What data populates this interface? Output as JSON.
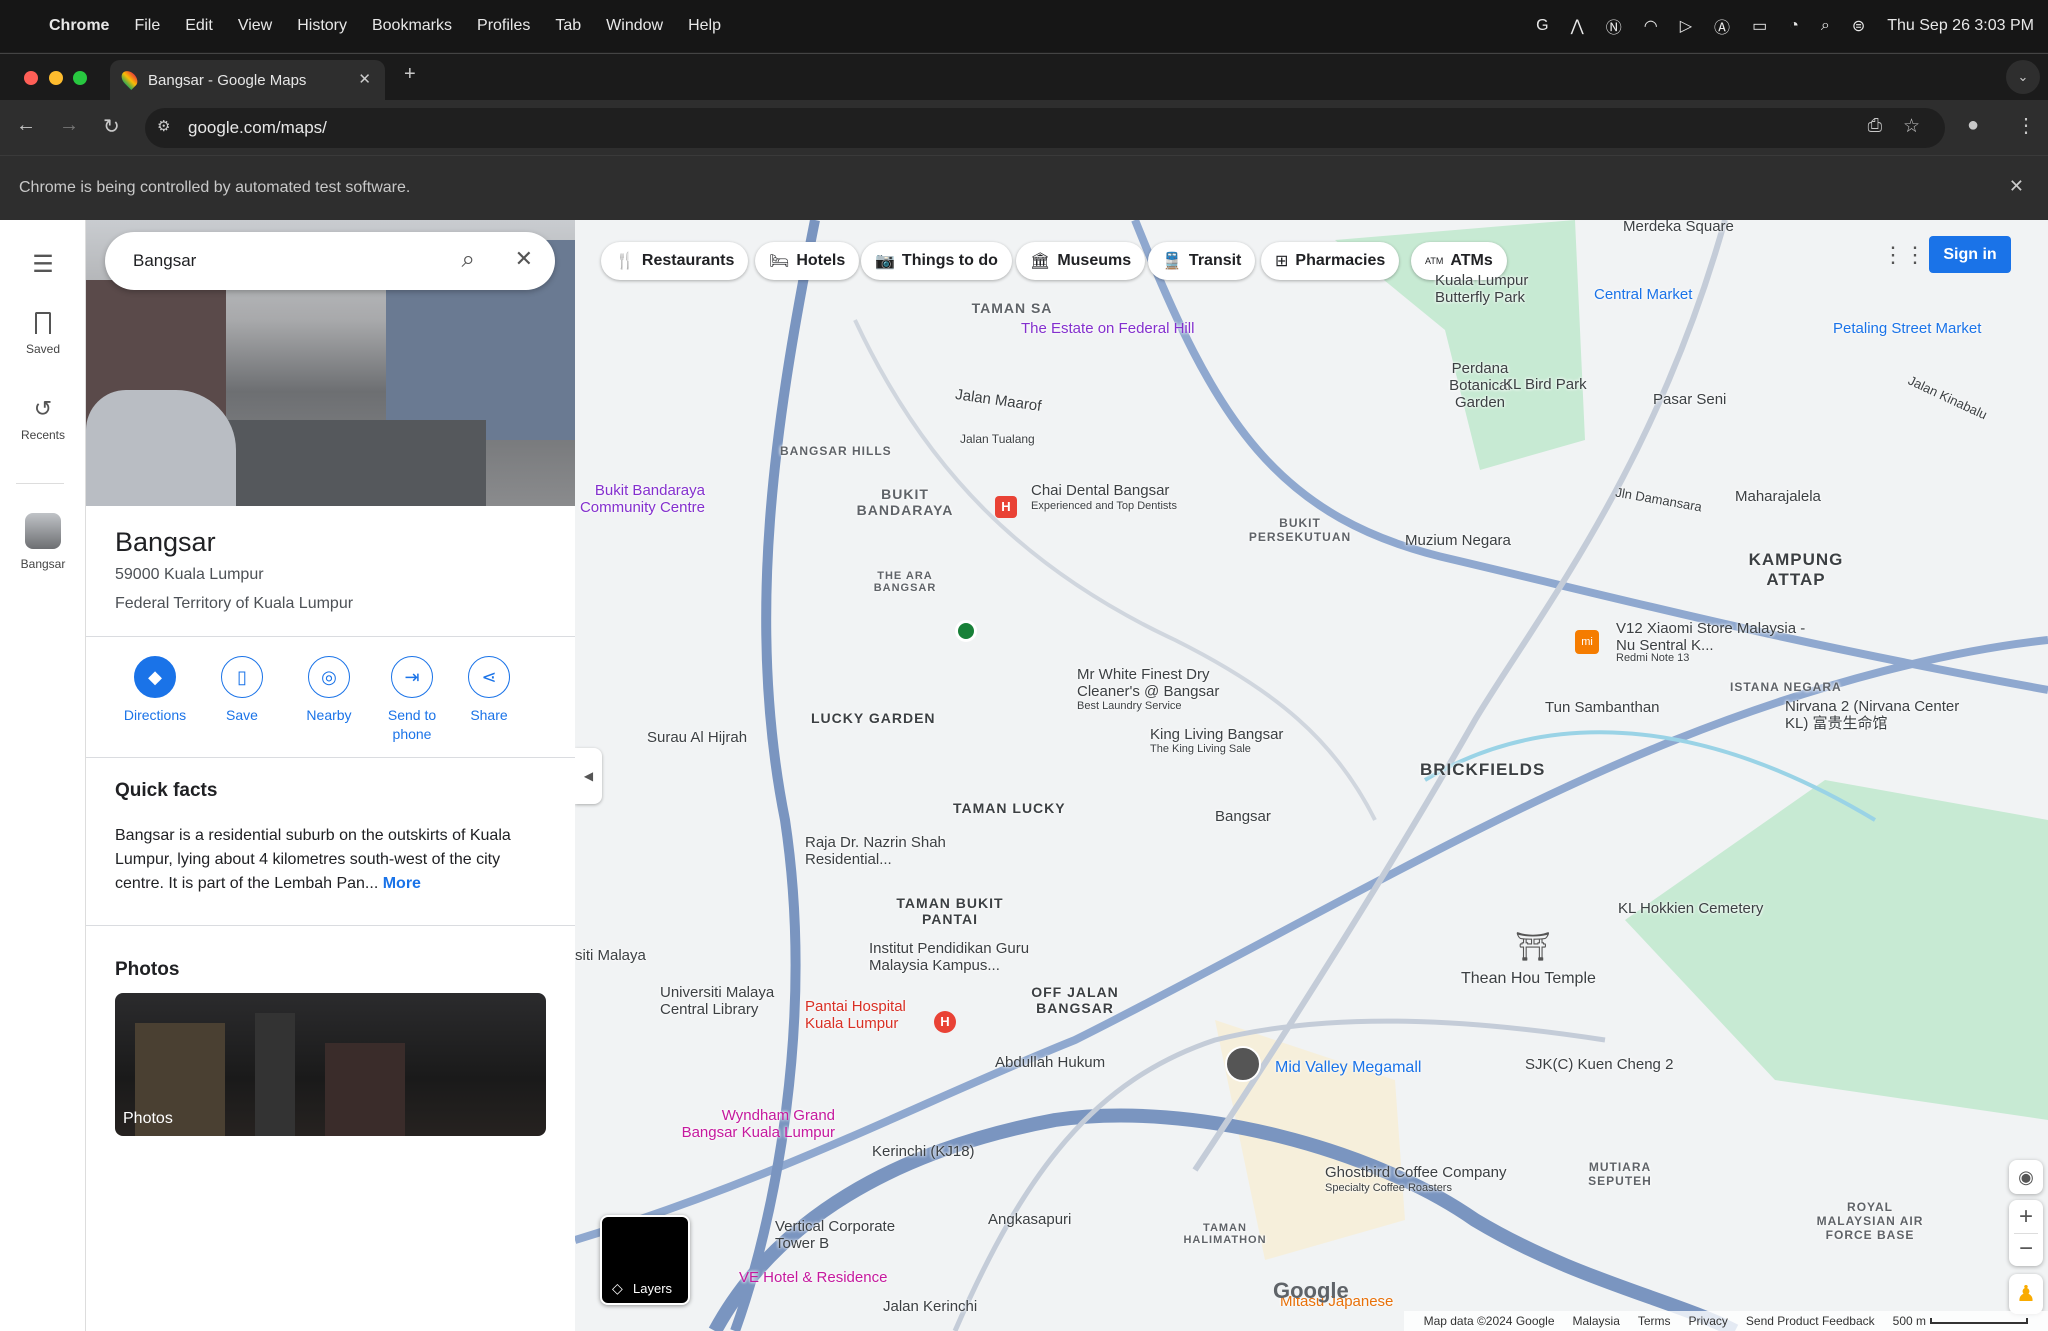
{
  "menubar": {
    "app": "Chrome",
    "items": [
      "File",
      "Edit",
      "View",
      "History",
      "Bookmarks",
      "Profiles",
      "Tab",
      "Window",
      "Help"
    ],
    "clock": "Thu Sep 26  3:03 PM"
  },
  "browser": {
    "tab_title": "Bangsar - Google Maps",
    "url": "google.com/maps/",
    "infobar": "Chrome is being controlled by automated test software."
  },
  "rail": {
    "saved": "Saved",
    "recents": "Recents",
    "recent_place": "Bangsar"
  },
  "search": {
    "value": "Bangsar"
  },
  "place": {
    "name": "Bangsar",
    "address1": "59000 Kuala Lumpur",
    "address2": "Federal Territory of Kuala Lumpur"
  },
  "actions": [
    "Directions",
    "Save",
    "Nearby",
    "Send to phone",
    "Share"
  ],
  "quick_facts": {
    "heading": "Quick facts",
    "text": "Bangsar is a residential suburb on the outskirts of Kuala Lumpur, lying about 4 kilometres south-west of the city centre. It is part of the Lembah Pan...",
    "more": "More"
  },
  "photos": {
    "heading": "Photos",
    "card_label": "Photos"
  },
  "chips": [
    "Restaurants",
    "Hotels",
    "Things to do",
    "Museums",
    "Transit",
    "Pharmacies",
    "ATMs"
  ],
  "sign_in": "Sign in",
  "layers": "Layers",
  "map": {
    "accent_color": "#1a73e8",
    "labels": [
      {
        "text": "TAMAN SA"
      },
      {
        "text": "The Estate on Federal Hill"
      },
      {
        "text": "Perdana Botanical Garden"
      },
      {
        "text": "KL Bird Park"
      },
      {
        "text": "Kuala Lumpur Butterfly Park"
      },
      {
        "text": "Central Market"
      },
      {
        "text": "Petaling Street Market"
      },
      {
        "text": "Merdeka Square"
      },
      {
        "text": "Pasar Seni"
      },
      {
        "text": "Maharajalela"
      },
      {
        "text": "KAMPUNG ATTAP"
      },
      {
        "text": "Muzium Negara"
      },
      {
        "text": "BUKIT PERSEKUTUAN"
      },
      {
        "text": "Chai Dental Bangsar"
      },
      {
        "text": "BUKIT BANDARAYA"
      },
      {
        "text": "BANGSAR HILLS"
      },
      {
        "text": "Jalan Maarof"
      },
      {
        "text": "Bukit Bandaraya Community Centre"
      },
      {
        "text": "THE ARA BANGSAR"
      },
      {
        "text": "V12 Xiaomi Store Malaysia - Nu Sentral K..."
      },
      {
        "text": "Mr White Finest Dry Cleaner's @ Bangsar"
      },
      {
        "text": "LUCKY GARDEN"
      },
      {
        "text": "King Living Bangsar"
      },
      {
        "text": "Tun Sambanthan"
      },
      {
        "text": "ISTANA NEGARA"
      },
      {
        "text": "Nirvana 2 (Nirvana Center KL) 富贵生命馆"
      },
      {
        "text": "BRICKFIELDS"
      },
      {
        "text": "Surau Al Hijrah"
      },
      {
        "text": "TAMAN LUCKY"
      },
      {
        "text": "Bangsar"
      },
      {
        "text": "Raja Dr. Nazrin Shah Residential..."
      },
      {
        "text": "TAMAN BUKIT PANTAI"
      },
      {
        "text": "Institut Pendidikan Guru Malaysia Kampus..."
      },
      {
        "text": "KL Hokkien Cemetery"
      },
      {
        "text": "Thean Hou Temple"
      },
      {
        "text": "siti Malaya"
      },
      {
        "text": "Universiti Malaya Central Library"
      },
      {
        "text": "Pantai Hospital Kuala Lumpur"
      },
      {
        "text": "OFF JALAN BANGSAR"
      },
      {
        "text": "Abdullah Hukum"
      },
      {
        "text": "Mid Valley Megamall"
      },
      {
        "text": "SJK(C) Kuen Cheng 2"
      },
      {
        "text": "Wyndham Grand Bangsar Kuala Lumpur"
      },
      {
        "text": "Kerinchi (KJ18)"
      },
      {
        "text": "Ghostbird Coffee Company"
      },
      {
        "text": "MUTIARA SEPUTEH"
      },
      {
        "text": "ROYAL MALAYSIAN AIR FORCE BASE"
      },
      {
        "text": "Vertical Corporate Tower B"
      },
      {
        "text": "Angkasapuri"
      },
      {
        "text": "TAMAN HALIMATHON"
      },
      {
        "text": "VE Hotel & Residence"
      },
      {
        "text": "Mitasu Japanese"
      },
      {
        "text": "Jalan Kerinchi"
      },
      {
        "text": "Jalan Tualang"
      },
      {
        "text": "Jalan Kinabalu"
      },
      {
        "text": "Jln Damansara"
      }
    ],
    "sublabels": [
      "Experienced and Top Dentists",
      "Redmi Note 13",
      "Best Laundry Service",
      "The King Living Sale",
      "Specialty Coffee Roasters"
    ]
  },
  "footer": {
    "items": [
      "Map data ©2024 Google",
      "Malaysia",
      "Terms",
      "Privacy",
      "Send Product Feedback"
    ],
    "scale": "500 m"
  }
}
